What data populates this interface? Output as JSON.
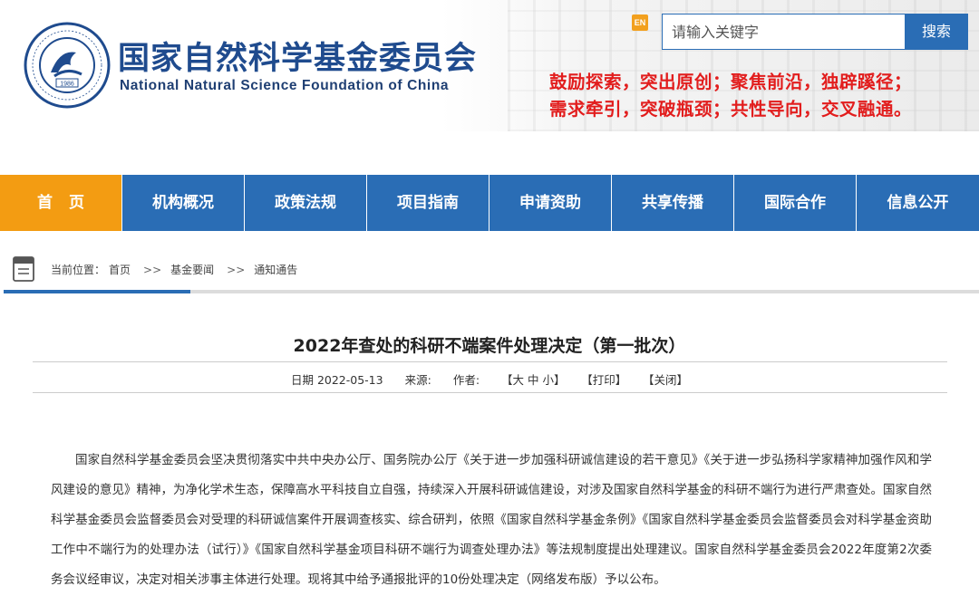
{
  "header": {
    "org_name_cn": "国家自然科学基金委员会",
    "org_name_en": "National Natural Science Foundation of China",
    "logo_year": "1986",
    "en_link": "EN",
    "search_placeholder": "请输入关键字",
    "search_button": "搜索",
    "slogan_line1": "鼓励探索，突出原创；聚焦前沿，独辟蹊径；",
    "slogan_line2": "需求牵引，突破瓶颈；共性导向，交叉融通。",
    "slogan_color": "#e21d1d",
    "brand_color": "#1f4b8e"
  },
  "nav": {
    "items": [
      "首页",
      "机构概况",
      "政策法规",
      "项目指南",
      "申请资助",
      "共享传播",
      "国际合作",
      "信息公开"
    ],
    "active_index": 0,
    "bar_color": "#2a6db5",
    "active_color": "#f39c12"
  },
  "breadcrumb": {
    "prefix": "当前位置：",
    "items": [
      "首页",
      "基金要闻",
      "通知通告"
    ],
    "separator": ">>"
  },
  "article": {
    "title": "2022年查处的科研不端案件处理决定（第一批次）",
    "meta": {
      "date": "日期 2022-05-13",
      "source": "来源:",
      "author": "作者:",
      "font_size": "【大 中 小】",
      "print": "【打印】",
      "close": "【关闭】"
    },
    "paragraphs": [
      "国家自然科学基金委员会坚决贯彻落实中共中央办公厅、国务院办公厅《关于进一步加强科研诚信建设的若干意见》《关于进一步弘扬科学家精神加强作风和学风建设的意见》精神，为净化学术生态，保障高水平科技自立自强，持续深入开展科研诚信建设，对涉及国家自然科学基金的科研不端行为进行严肃查处。国家自然科学基金委员会监督委员会对受理的科研诚信案件开展调查核实、综合研判，依照《国家自然科学基金条例》《国家自然科学基金委员会监督委员会对科学基金资助工作中不端行为的处理办法（试行）》《国家自然科学基金项目科研不端行为调查处理办法》等法规制度提出处理建议。国家自然科学基金委员会2022年度第2次委务会议经审议，决定对相关涉事主体进行处理。现将其中给予通报批评的10份处理决定（网络发布版）予以公布。"
    ]
  }
}
